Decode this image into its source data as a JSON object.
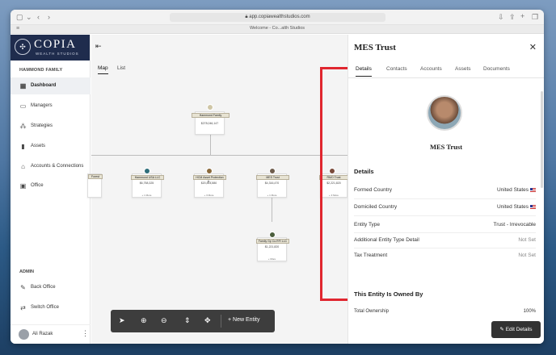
{
  "browser": {
    "url": "app.copiawealthstudios.com",
    "tab_title": "Welcome - Co...alth Studios"
  },
  "brand": {
    "name": "COPIA",
    "tagline": "WEALTH STUDIOS"
  },
  "sidebar": {
    "family": "HAMMOND FAMILY",
    "items": [
      {
        "label": "Dashboard",
        "icon": "grid-icon"
      },
      {
        "label": "Managers",
        "icon": "id-card-icon"
      },
      {
        "label": "Strategies",
        "icon": "nodes-icon"
      },
      {
        "label": "Assets",
        "icon": "bar-chart-icon"
      },
      {
        "label": "Accounts & Connections",
        "icon": "bank-icon"
      },
      {
        "label": "Office",
        "icon": "office-icon"
      }
    ],
    "admin_header": "ADMIN",
    "admin_items": [
      {
        "label": "Back Office",
        "icon": "wrench-icon"
      },
      {
        "label": "Switch Office",
        "icon": "swap-icon"
      }
    ],
    "user": "Ali Razak"
  },
  "map": {
    "tabs": [
      "Map",
      "List"
    ],
    "root": {
      "name": "Hammond Family",
      "value": "$278,046,147"
    },
    "children": [
      {
        "name": "Hammond USA LLC",
        "value": "$6,758,325",
        "more": "+ 1 More"
      },
      {
        "name": "HCM Asset Protection &...",
        "value": "$20,814,880",
        "more": "+ 3 More"
      },
      {
        "name": "MES Trust",
        "value": "$4,316,470",
        "more": "+ 1 More"
      },
      {
        "name": "RMO Trust",
        "value": "$2,221,820",
        "more": "+ 3 More"
      },
      {
        "name": "Family Gp Co.RFI LLC",
        "value": "$1,221,820",
        "more": "+ More"
      }
    ],
    "partial_left": "Forest",
    "new_entity": "New Entity"
  },
  "panel": {
    "title": "MES Trust",
    "tabs": [
      "Details",
      "Contacts",
      "Accounts",
      "Assets",
      "Documents"
    ],
    "entity_name": "MES Trust",
    "details_header": "Details",
    "details": [
      {
        "key": "Formed Country",
        "value": "United States",
        "flag": true
      },
      {
        "key": "Domiciled Country",
        "value": "United States",
        "flag": true
      },
      {
        "key": "Entity Type",
        "value": "Trust - Irrevocable"
      },
      {
        "key": "Additional Entity Type Detail",
        "value": "Not Set",
        "muted": true
      },
      {
        "key": "Tax Treatment",
        "value": "Not Set",
        "muted": true
      }
    ],
    "owned_header": "This Entity Is Owned By",
    "ownership": {
      "key": "Total Ownership",
      "value": "100%"
    },
    "edit_button": "Edit Details"
  },
  "colors": {
    "sidebar_brand": "#1f2c4d",
    "highlight": "#e0262f",
    "toolbar": "#3d3d3d"
  }
}
